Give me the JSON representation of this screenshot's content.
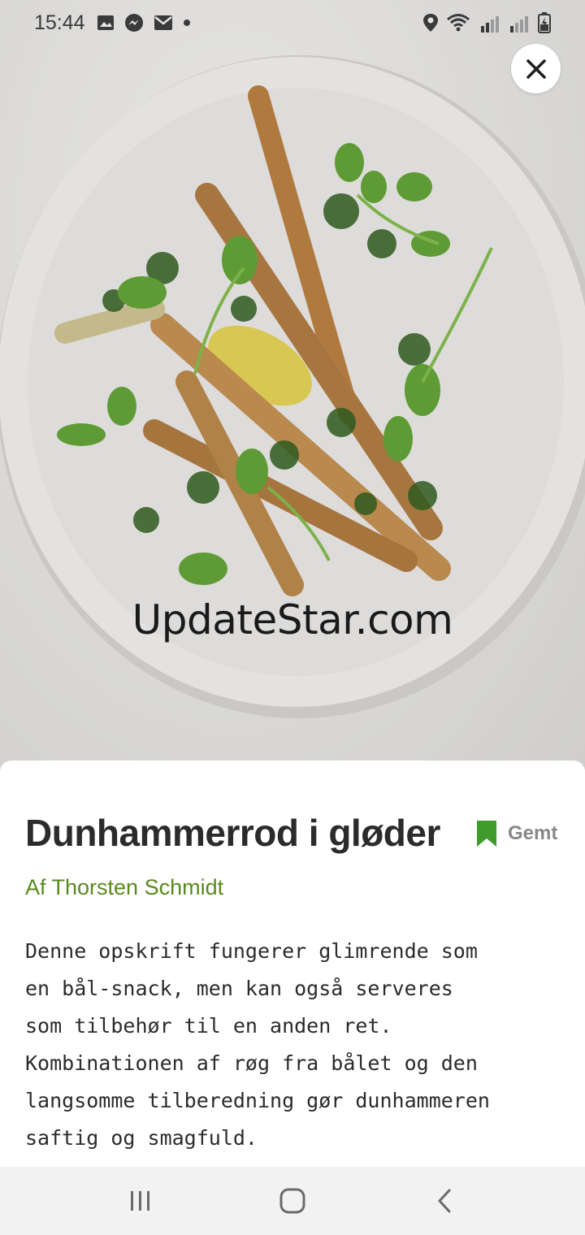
{
  "status_bar": {
    "time": "15:44",
    "left_icons": [
      "image-icon",
      "messenger-icon",
      "mail-icon",
      "dot-icon"
    ],
    "right_icons": [
      "location-icon",
      "wifi-icon",
      "signal-icon",
      "signal-icon",
      "battery-icon"
    ]
  },
  "hero": {
    "image": "food-photo",
    "watermark": "UpdateStar.com"
  },
  "recipe": {
    "title": "Dunhammerrod i gløder",
    "save_label": "Gemt",
    "author": "Af Thorsten Schmidt",
    "description": "Denne opskrift fungerer glimrende som\nen bål-snack, men kan også serveres\nsom tilbehør til en anden ret.\nKombinationen af røg fra bålet og den\nlangsomme tilberedning gør dunhammeren\nsaftig og smagfuld."
  },
  "colors": {
    "accent_green": "#5a8a1e",
    "bookmark_green": "#3e9b2c",
    "text_dark": "#2b2b2b"
  },
  "nav_bar": {
    "buttons": [
      "recent-apps-icon",
      "home-icon",
      "back-icon"
    ]
  }
}
